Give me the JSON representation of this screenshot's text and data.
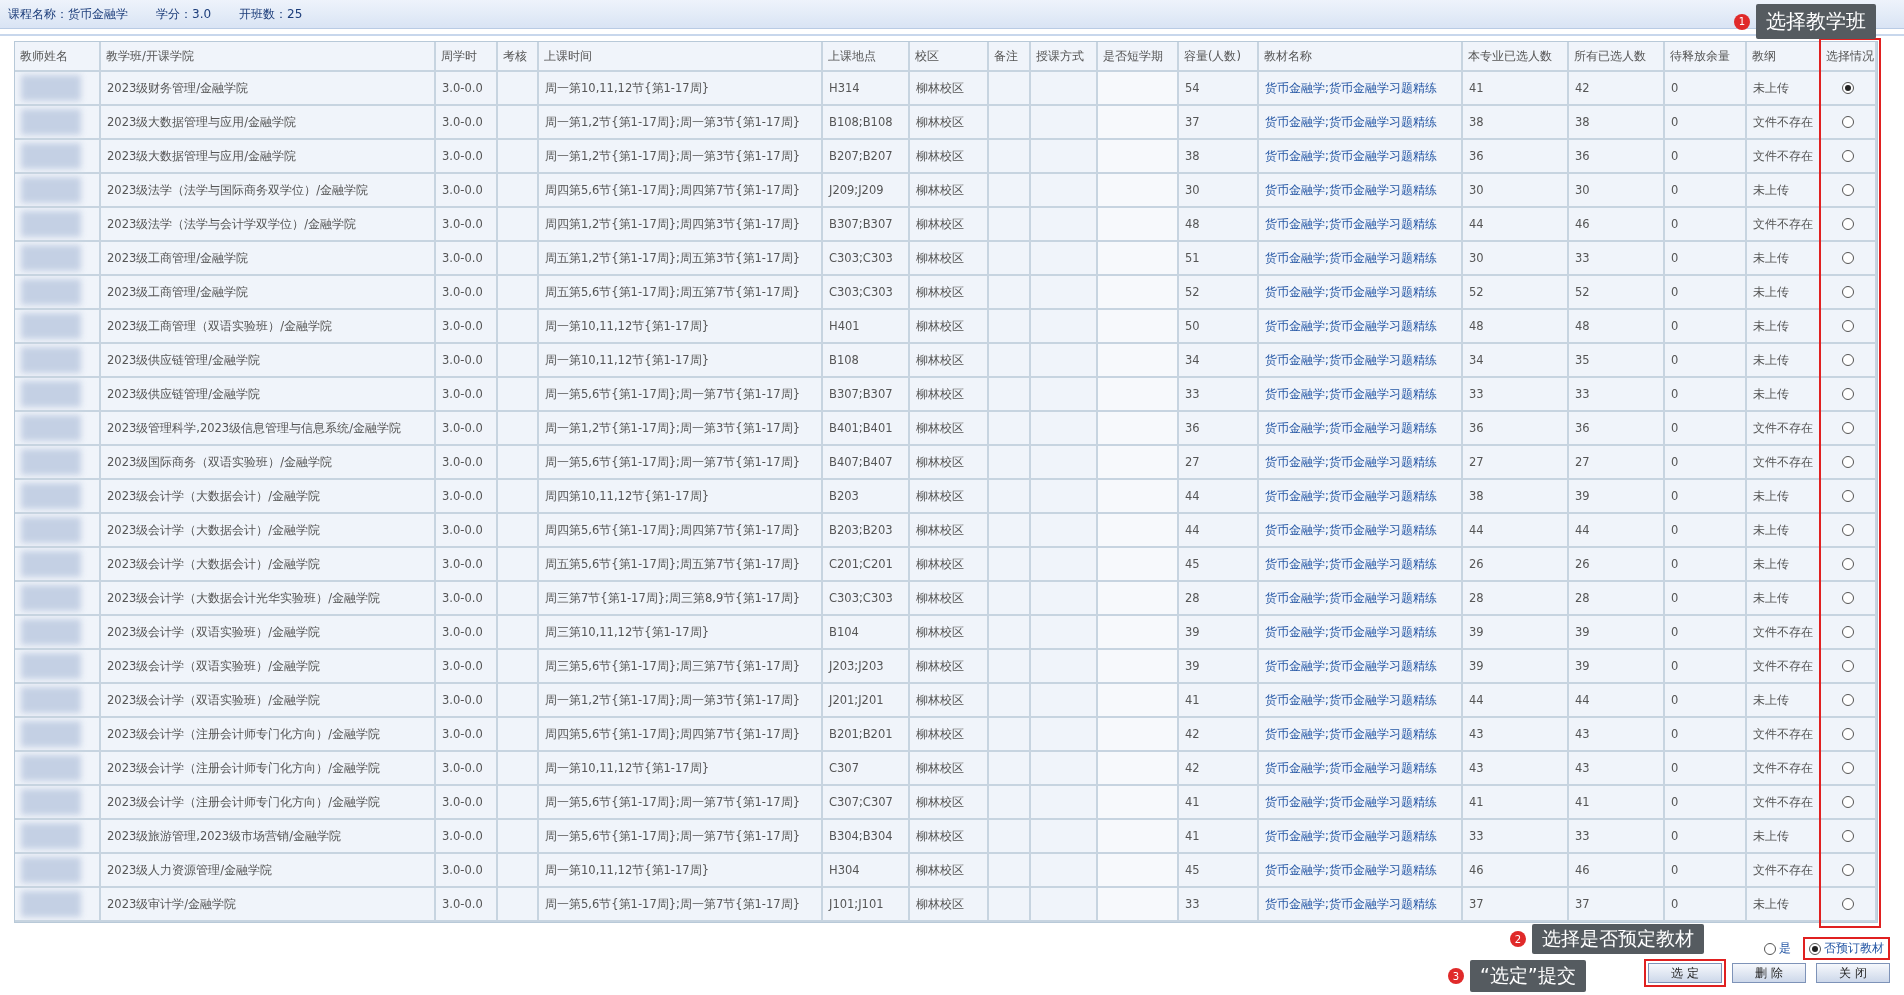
{
  "course_info": [
    "课程名称：货币金融学",
    "学分：3.0",
    "开班数：25"
  ],
  "table": {
    "columns": [
      "教师姓名",
      "教学班/开课学院",
      "周学时",
      "考核",
      "上课时间",
      "上课地点",
      "校区",
      "备注",
      "授课方式",
      "是否短学期",
      "容量(人数)",
      "教材名称",
      "本专业已选人数",
      "所有已选人数",
      "待释放余量",
      "教纲",
      "选择情况"
    ],
    "rows": [
      {
        "class": "2023级财务管理/金融学院",
        "hours": "3.0-0.0",
        "time": "周一第10,11,12节{第1-17周}",
        "room": "H314",
        "campus": "柳林校区",
        "capacity": "54",
        "textbook": "货币金融学;货币金融学习题精练",
        "major_count": "41",
        "total_count": "42",
        "pending": "0",
        "syllabus": "未上传",
        "selected": true
      },
      {
        "class": "2023级大数据管理与应用/金融学院",
        "hours": "3.0-0.0",
        "time": "周一第1,2节{第1-17周};周一第3节{第1-17周}",
        "room": "B108;B108",
        "campus": "柳林校区",
        "capacity": "37",
        "textbook": "货币金融学;货币金融学习题精练",
        "major_count": "38",
        "total_count": "38",
        "pending": "0",
        "syllabus": "文件不存在",
        "selected": false
      },
      {
        "class": "2023级大数据管理与应用/金融学院",
        "hours": "3.0-0.0",
        "time": "周一第1,2节{第1-17周};周一第3节{第1-17周}",
        "room": "B207;B207",
        "campus": "柳林校区",
        "capacity": "38",
        "textbook": "货币金融学;货币金融学习题精练",
        "major_count": "36",
        "total_count": "36",
        "pending": "0",
        "syllabus": "文件不存在",
        "selected": false
      },
      {
        "class": "2023级法学（法学与国际商务双学位）/金融学院",
        "hours": "3.0-0.0",
        "time": "周四第5,6节{第1-17周};周四第7节{第1-17周}",
        "room": "J209;J209",
        "campus": "柳林校区",
        "capacity": "30",
        "textbook": "货币金融学;货币金融学习题精练",
        "major_count": "30",
        "total_count": "30",
        "pending": "0",
        "syllabus": "未上传",
        "selected": false
      },
      {
        "class": "2023级法学（法学与会计学双学位）/金融学院",
        "hours": "3.0-0.0",
        "time": "周四第1,2节{第1-17周};周四第3节{第1-17周}",
        "room": "B307;B307",
        "campus": "柳林校区",
        "capacity": "48",
        "textbook": "货币金融学;货币金融学习题精练",
        "major_count": "44",
        "total_count": "46",
        "pending": "0",
        "syllabus": "文件不存在",
        "selected": false
      },
      {
        "class": "2023级工商管理/金融学院",
        "hours": "3.0-0.0",
        "time": "周五第1,2节{第1-17周};周五第3节{第1-17周}",
        "room": "C303;C303",
        "campus": "柳林校区",
        "capacity": "51",
        "textbook": "货币金融学;货币金融学习题精练",
        "major_count": "30",
        "total_count": "33",
        "pending": "0",
        "syllabus": "未上传",
        "selected": false
      },
      {
        "class": "2023级工商管理/金融学院",
        "hours": "3.0-0.0",
        "time": "周五第5,6节{第1-17周};周五第7节{第1-17周}",
        "room": "C303;C303",
        "campus": "柳林校区",
        "capacity": "52",
        "textbook": "货币金融学;货币金融学习题精练",
        "major_count": "52",
        "total_count": "52",
        "pending": "0",
        "syllabus": "未上传",
        "selected": false
      },
      {
        "class": "2023级工商管理（双语实验班）/金融学院",
        "hours": "3.0-0.0",
        "time": "周一第10,11,12节{第1-17周}",
        "room": "H401",
        "campus": "柳林校区",
        "capacity": "50",
        "textbook": "货币金融学;货币金融学习题精练",
        "major_count": "48",
        "total_count": "48",
        "pending": "0",
        "syllabus": "未上传",
        "selected": false
      },
      {
        "class": "2023级供应链管理/金融学院",
        "hours": "3.0-0.0",
        "time": "周一第10,11,12节{第1-17周}",
        "room": "B108",
        "campus": "柳林校区",
        "capacity": "34",
        "textbook": "货币金融学;货币金融学习题精练",
        "major_count": "34",
        "total_count": "35",
        "pending": "0",
        "syllabus": "未上传",
        "selected": false
      },
      {
        "class": "2023级供应链管理/金融学院",
        "hours": "3.0-0.0",
        "time": "周一第5,6节{第1-17周};周一第7节{第1-17周}",
        "room": "B307;B307",
        "campus": "柳林校区",
        "capacity": "33",
        "textbook": "货币金融学;货币金融学习题精练",
        "major_count": "33",
        "total_count": "33",
        "pending": "0",
        "syllabus": "未上传",
        "selected": false
      },
      {
        "class": "2023级管理科学,2023级信息管理与信息系统/金融学院",
        "hours": "3.0-0.0",
        "time": "周一第1,2节{第1-17周};周一第3节{第1-17周}",
        "room": "B401;B401",
        "campus": "柳林校区",
        "capacity": "36",
        "textbook": "货币金融学;货币金融学习题精练",
        "major_count": "36",
        "total_count": "36",
        "pending": "0",
        "syllabus": "文件不存在",
        "selected": false
      },
      {
        "class": "2023级国际商务（双语实验班）/金融学院",
        "hours": "3.0-0.0",
        "time": "周一第5,6节{第1-17周};周一第7节{第1-17周}",
        "room": "B407;B407",
        "campus": "柳林校区",
        "capacity": "27",
        "textbook": "货币金融学;货币金融学习题精练",
        "major_count": "27",
        "total_count": "27",
        "pending": "0",
        "syllabus": "文件不存在",
        "selected": false
      },
      {
        "class": "2023级会计学（大数据会计）/金融学院",
        "hours": "3.0-0.0",
        "time": "周四第10,11,12节{第1-17周}",
        "room": "B203",
        "campus": "柳林校区",
        "capacity": "44",
        "textbook": "货币金融学;货币金融学习题精练",
        "major_count": "38",
        "total_count": "39",
        "pending": "0",
        "syllabus": "未上传",
        "selected": false
      },
      {
        "class": "2023级会计学（大数据会计）/金融学院",
        "hours": "3.0-0.0",
        "time": "周四第5,6节{第1-17周};周四第7节{第1-17周}",
        "room": "B203;B203",
        "campus": "柳林校区",
        "capacity": "44",
        "textbook": "货币金融学;货币金融学习题精练",
        "major_count": "44",
        "total_count": "44",
        "pending": "0",
        "syllabus": "未上传",
        "selected": false
      },
      {
        "class": "2023级会计学（大数据会计）/金融学院",
        "hours": "3.0-0.0",
        "time": "周五第5,6节{第1-17周};周五第7节{第1-17周}",
        "room": "C201;C201",
        "campus": "柳林校区",
        "capacity": "45",
        "textbook": "货币金融学;货币金融学习题精练",
        "major_count": "26",
        "total_count": "26",
        "pending": "0",
        "syllabus": "未上传",
        "selected": false
      },
      {
        "class": "2023级会计学（大数据会计光华实验班）/金融学院",
        "hours": "3.0-0.0",
        "time": "周三第7节{第1-17周};周三第8,9节{第1-17周}",
        "room": "C303;C303",
        "campus": "柳林校区",
        "capacity": "28",
        "textbook": "货币金融学;货币金融学习题精练",
        "major_count": "28",
        "total_count": "28",
        "pending": "0",
        "syllabus": "未上传",
        "selected": false
      },
      {
        "class": "2023级会计学（双语实验班）/金融学院",
        "hours": "3.0-0.0",
        "time": "周三第10,11,12节{第1-17周}",
        "room": "B104",
        "campus": "柳林校区",
        "capacity": "39",
        "textbook": "货币金融学;货币金融学习题精练",
        "major_count": "39",
        "total_count": "39",
        "pending": "0",
        "syllabus": "文件不存在",
        "selected": false
      },
      {
        "class": "2023级会计学（双语实验班）/金融学院",
        "hours": "3.0-0.0",
        "time": "周三第5,6节{第1-17周};周三第7节{第1-17周}",
        "room": "J203;J203",
        "campus": "柳林校区",
        "capacity": "39",
        "textbook": "货币金融学;货币金融学习题精练",
        "major_count": "39",
        "total_count": "39",
        "pending": "0",
        "syllabus": "文件不存在",
        "selected": false
      },
      {
        "class": "2023级会计学（双语实验班）/金融学院",
        "hours": "3.0-0.0",
        "time": "周一第1,2节{第1-17周};周一第3节{第1-17周}",
        "room": "J201;J201",
        "campus": "柳林校区",
        "capacity": "41",
        "textbook": "货币金融学;货币金融学习题精练",
        "major_count": "44",
        "total_count": "44",
        "pending": "0",
        "syllabus": "未上传",
        "selected": false
      },
      {
        "class": "2023级会计学（注册会计师专门化方向）/金融学院",
        "hours": "3.0-0.0",
        "time": "周四第5,6节{第1-17周};周四第7节{第1-17周}",
        "room": "B201;B201",
        "campus": "柳林校区",
        "capacity": "42",
        "textbook": "货币金融学;货币金融学习题精练",
        "major_count": "43",
        "total_count": "43",
        "pending": "0",
        "syllabus": "文件不存在",
        "selected": false
      },
      {
        "class": "2023级会计学（注册会计师专门化方向）/金融学院",
        "hours": "3.0-0.0",
        "time": "周一第10,11,12节{第1-17周}",
        "room": "C307",
        "campus": "柳林校区",
        "capacity": "42",
        "textbook": "货币金融学;货币金融学习题精练",
        "major_count": "43",
        "total_count": "43",
        "pending": "0",
        "syllabus": "文件不存在",
        "selected": false
      },
      {
        "class": "2023级会计学（注册会计师专门化方向）/金融学院",
        "hours": "3.0-0.0",
        "time": "周一第5,6节{第1-17周};周一第7节{第1-17周}",
        "room": "C307;C307",
        "campus": "柳林校区",
        "capacity": "41",
        "textbook": "货币金融学;货币金融学习题精练",
        "major_count": "41",
        "total_count": "41",
        "pending": "0",
        "syllabus": "文件不存在",
        "selected": false
      },
      {
        "class": "2023级旅游管理,2023级市场营销/金融学院",
        "hours": "3.0-0.0",
        "time": "周一第5,6节{第1-17周};周一第7节{第1-17周}",
        "room": "B304;B304",
        "campus": "柳林校区",
        "capacity": "41",
        "textbook": "货币金融学;货币金融学习题精练",
        "major_count": "33",
        "total_count": "33",
        "pending": "0",
        "syllabus": "未上传",
        "selected": false
      },
      {
        "class": "2023级人力资源管理/金融学院",
        "hours": "3.0-0.0",
        "time": "周一第10,11,12节{第1-17周}",
        "room": "H304",
        "campus": "柳林校区",
        "capacity": "45",
        "textbook": "货币金融学;货币金融学习题精练",
        "major_count": "46",
        "total_count": "46",
        "pending": "0",
        "syllabus": "文件不存在",
        "selected": false
      },
      {
        "class": "2023级审计学/金融学院",
        "hours": "3.0-0.0",
        "time": "周一第5,6节{第1-17周};周一第7节{第1-17周}",
        "room": "J101;J101",
        "campus": "柳林校区",
        "capacity": "33",
        "textbook": "货币金融学;货币金融学习题精练",
        "major_count": "37",
        "total_count": "37",
        "pending": "0",
        "syllabus": "未上传",
        "selected": false
      }
    ]
  },
  "textbook_order": [
    {
      "label": "是",
      "selected": false
    },
    {
      "label": "否预订教材",
      "selected": true
    }
  ],
  "buttons": [
    "选 定",
    "删 除",
    "关 闭"
  ],
  "callouts": [
    {
      "number": "1",
      "text": "选择教学班"
    },
    {
      "number": "2",
      "text": "选择是否预定教材"
    },
    {
      "number": "3",
      "text": "“选定”提交"
    }
  ]
}
